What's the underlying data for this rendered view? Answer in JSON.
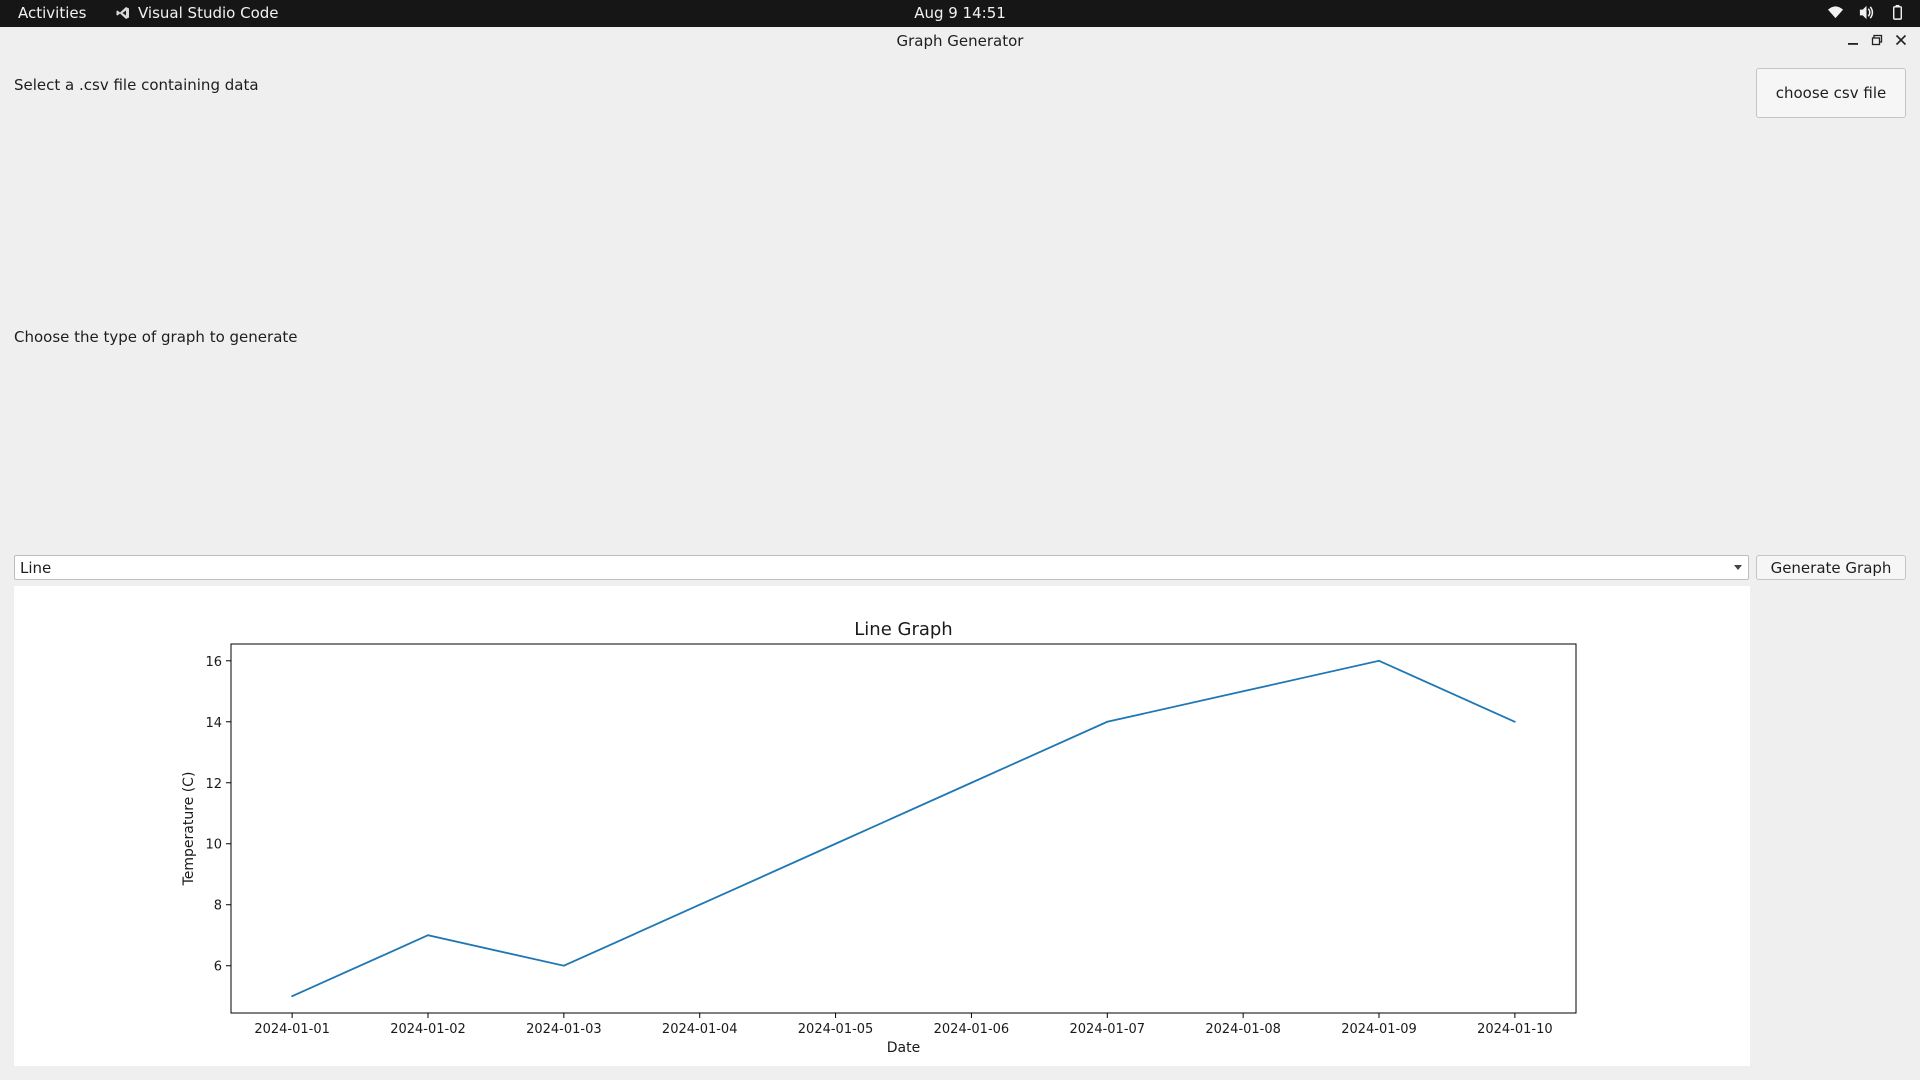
{
  "topbar": {
    "activities": "Activities",
    "app_name": "Visual Studio Code",
    "clock": "Aug 9  14:51",
    "tray_icons": [
      "wifi-icon",
      "volume-icon",
      "battery-icon"
    ]
  },
  "window": {
    "title": "Graph Generator",
    "controls": [
      "minimize-icon",
      "maximize-icon",
      "close-icon"
    ]
  },
  "main": {
    "csv_prompt": "Select a .csv file containing data",
    "choose_button": "choose csv file",
    "graph_type_prompt": "Choose the type of graph to generate",
    "graph_type_selected": "Line",
    "generate_button": "Generate Graph"
  },
  "colors": {
    "line": "#1f77b4",
    "topbar": "#161616",
    "window_bg": "#efefef"
  },
  "chart_data": {
    "type": "line",
    "title": "Line Graph",
    "xlabel": "Date",
    "ylabel": "Temperature (C)",
    "x": [
      "2024-01-01",
      "2024-01-02",
      "2024-01-03",
      "2024-01-04",
      "2024-01-05",
      "2024-01-06",
      "2024-01-07",
      "2024-01-08",
      "2024-01-09",
      "2024-01-10"
    ],
    "values": [
      5,
      7,
      6,
      8,
      10,
      12,
      14,
      15,
      16,
      14
    ],
    "yticks": [
      6,
      8,
      10,
      12,
      14,
      16
    ],
    "ylim": [
      4.45,
      16.55
    ],
    "grid": false
  }
}
